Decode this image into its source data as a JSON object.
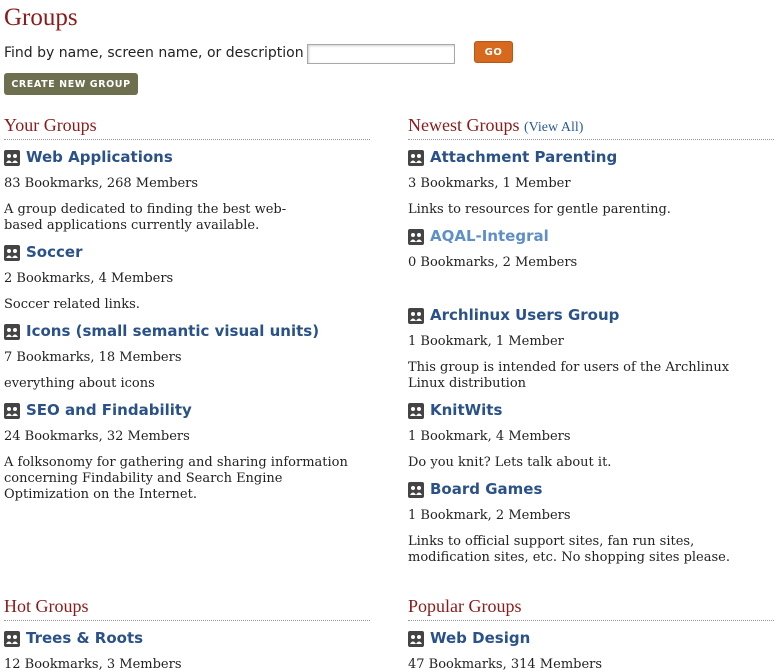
{
  "page_title": "Groups",
  "search": {
    "label": "Find by name, screen name, or description",
    "value": "",
    "placeholder": "",
    "go_label": "GO"
  },
  "create_button_label": "CREATE NEW GROUP",
  "your_groups": {
    "title": "Your Groups",
    "items": [
      {
        "name": "Web Applications",
        "stats": "83 Bookmarks, 268 Members",
        "description": "A group dedicated to finding the best web-based applications currently available."
      },
      {
        "name": "Soccer",
        "stats": "2 Bookmarks, 4 Members",
        "description": "Soccer related links."
      },
      {
        "name": "Icons (small semantic visual units)",
        "stats": "7 Bookmarks, 18 Members",
        "description": "everything about icons"
      },
      {
        "name": "SEO and Findability",
        "stats": "24 Bookmarks, 32 Members",
        "description": "A folksonomy for gathering and sharing information concerning Findability and Search Engine Optimization on the Internet."
      }
    ]
  },
  "newest_groups": {
    "title": "Newest Groups",
    "view_all": "(View All)",
    "items": [
      {
        "name": "Attachment Parenting",
        "stats": "3 Bookmarks, 1 Member",
        "description": "Links to resources for gentle parenting."
      },
      {
        "name": "AQAL-Integral",
        "stats": "0 Bookmarks, 2 Members",
        "description": ""
      },
      {
        "name": "Archlinux Users Group",
        "stats": "1 Bookmark, 1 Member",
        "description": "This group is intended for users of the Archlinux Linux distribution"
      },
      {
        "name": "KnitWits",
        "stats": "1 Bookmark, 4 Members",
        "description": "Do you knit? Lets talk about it."
      },
      {
        "name": "Board Games",
        "stats": "1 Bookmark, 2 Members",
        "description": "Links to official support sites, fan run sites, modification sites, etc. No shopping sites please."
      }
    ]
  },
  "hot_groups": {
    "title": "Hot Groups",
    "items": [
      {
        "name": "Trees & Roots",
        "stats": "12 Bookmarks, 3 Members"
      }
    ]
  },
  "popular_groups": {
    "title": "Popular Groups",
    "items": [
      {
        "name": "Web Design",
        "stats": "47 Bookmarks, 314 Members"
      }
    ]
  }
}
